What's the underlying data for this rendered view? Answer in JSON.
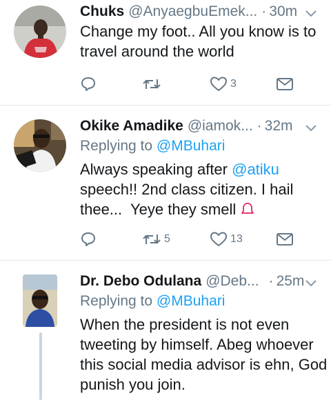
{
  "tweets": [
    {
      "name": "Chuks",
      "handle": "@AnyaegbuEmek...",
      "separator": "·",
      "time": "30m",
      "replying_prefix": "",
      "replying_to": "",
      "text": "Change my foot.. All you know is to travel around the world",
      "counts": {
        "reply": "",
        "retweet": "",
        "like": "3",
        "dm": ""
      }
    },
    {
      "name": "Okike Amadike",
      "handle": "@iamok...",
      "separator": "·",
      "time": "32m",
      "replying_prefix": "Replying to",
      "replying_to": "@MBuhari",
      "text_parts": [
        "Always speaking after ",
        "@atiku",
        " speech!! 2nd class citizen. I hail thee...  Yeye they smell "
      ],
      "emoji": "bell",
      "counts": {
        "reply": "",
        "retweet": "5",
        "like": "13",
        "dm": ""
      }
    },
    {
      "name": "Dr. Debo Odulana",
      "handle": "@Deb...",
      "separator": "·",
      "time": "25m",
      "replying_prefix": "Replying to",
      "replying_to": "@MBuhari",
      "text": "When the president is not even tweeting by himself. Abeg whoever this social media advisor is ehn, God punish you join."
    }
  ],
  "icons": {
    "reply": "reply-icon",
    "retweet": "retweet-icon",
    "like": "heart-icon",
    "dm": "envelope-icon",
    "menu": "chevron-down-icon"
  },
  "colors": {
    "text": "#14171a",
    "secondary": "#657786",
    "link": "#1da1f2",
    "divider": "#e1e8ed",
    "emoji": "#e0245e"
  }
}
